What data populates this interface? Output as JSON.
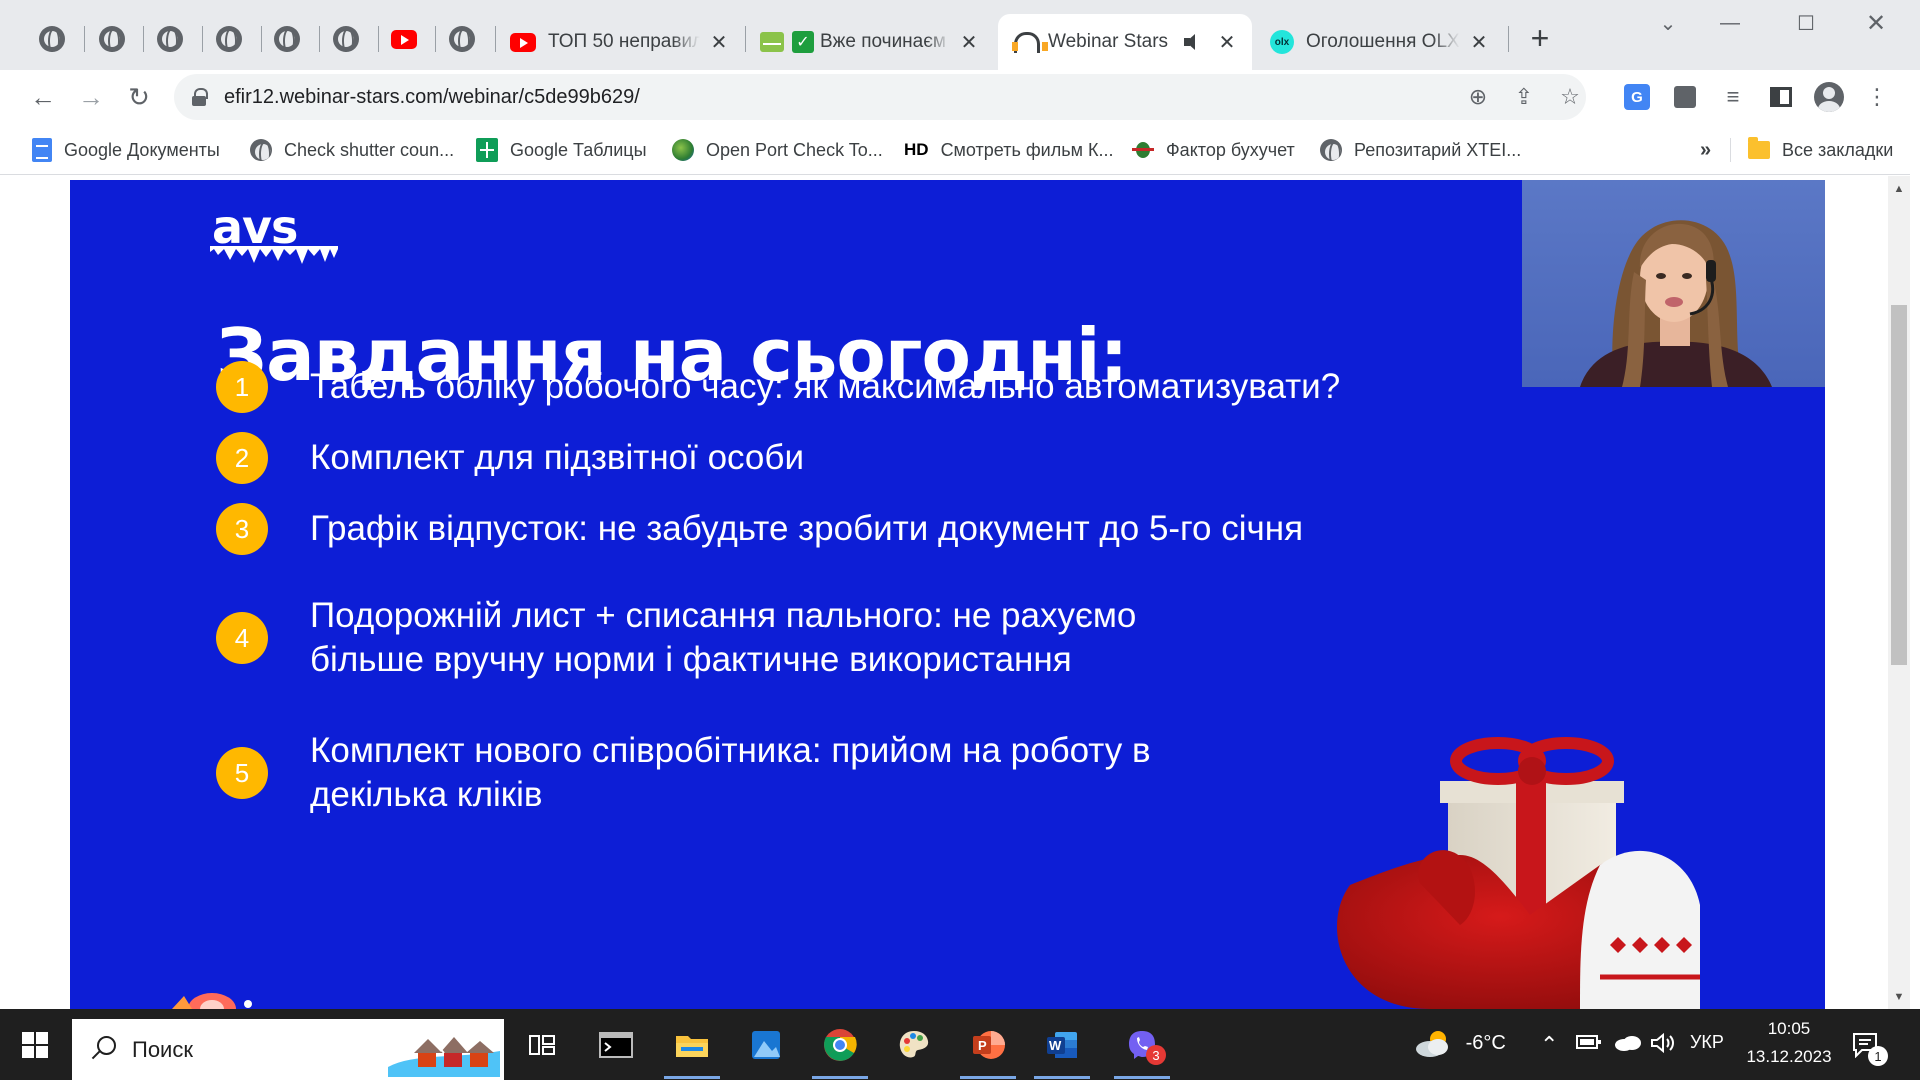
{
  "browser": {
    "tabs": [
      {
        "label": "ТОП 50 неправиль",
        "icon": "youtube-icon"
      },
      {
        "label": "Вже починаєм",
        "icon": "check-icon"
      },
      {
        "label": "Webinar Stars",
        "icon": "headset-icon",
        "active": true
      },
      {
        "label": "Оголошення OLX.u",
        "icon": "olx-icon"
      }
    ],
    "url": "efir12.webinar-stars.com/webinar/c5de99b629/"
  },
  "bookmarks": [
    {
      "label": "Google Документы",
      "icon": "google-docs-icon"
    },
    {
      "label": "Check shutter coun...",
      "icon": "globe-icon"
    },
    {
      "label": "Google Таблицы",
      "icon": "google-sheets-icon"
    },
    {
      "label": "Open Port Check To...",
      "icon": "earth-icon"
    },
    {
      "label": "Смотреть фильм К...",
      "icon": "hd-icon",
      "icon_text": "HD"
    },
    {
      "label": "Фактор бухучет",
      "icon": "bug-icon"
    },
    {
      "label": "Репозитарий XTEI...",
      "icon": "globe-icon"
    }
  ],
  "bookmarks_more": "»",
  "all_bookmarks": "Все закладки",
  "slide": {
    "logo": "avs",
    "title": "Завдання на сьогодні:",
    "tasks": [
      {
        "num": "1",
        "lines": [
          "Табель обліку робочого часу: як максимально автоматизувати?"
        ]
      },
      {
        "num": "2",
        "lines": [
          "Комплект для підзвітної особи"
        ]
      },
      {
        "num": "3",
        "lines": [
          "Графік відпусток: не забудьте зробити документ до 5-го січня"
        ]
      },
      {
        "num": "4",
        "lines": [
          "Подорожній лист + списання пального: не рахуємо",
          "більше вручну норми і фактичне використання"
        ]
      },
      {
        "num": "5",
        "lines": [
          "Комплект нового співробітника: прийом на роботу в",
          "декілька кліків"
        ]
      }
    ],
    "colors": {
      "background": "#0d1ed6",
      "number_badge": "#ffb800",
      "text": "#ffffff"
    }
  },
  "taskbar": {
    "search_placeholder": "Поиск",
    "weather": "-6°C",
    "language": "УКР",
    "time": "10:05",
    "date": "13.12.2023",
    "viber_badge": "3",
    "notification_badge": "1"
  }
}
